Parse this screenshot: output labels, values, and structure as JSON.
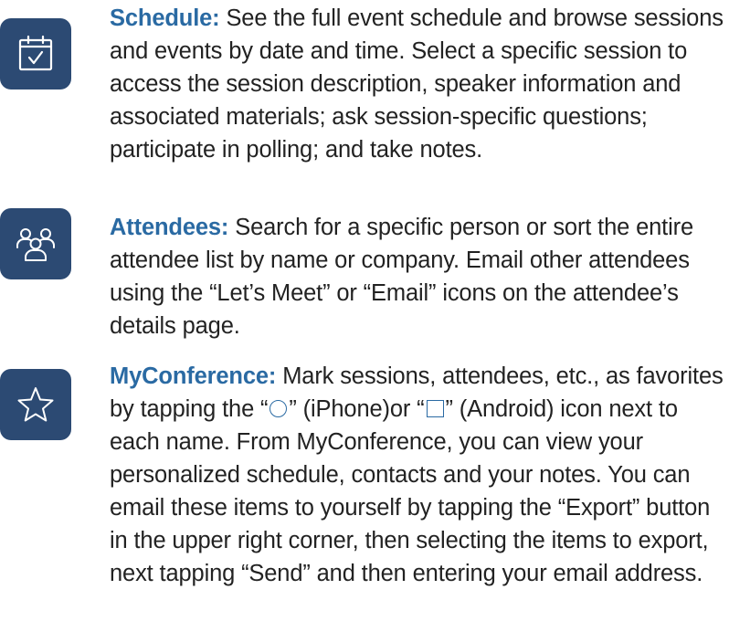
{
  "colors": {
    "icon_tile": "#2c4a73",
    "title": "#2a6aa3",
    "body_text": "#222222"
  },
  "items": [
    {
      "icon": "calendar-check-icon",
      "title": "Schedule:",
      "body": " See the full event schedule and browse sessions and events by date and time. Select a specific session to access the session description, speaker information and associated materials; ask session-specific questions; participate in polling; and take notes."
    },
    {
      "icon": "attendees-group-icon",
      "title": "Attendees:",
      "body": " Search for a specific person or sort the entire attendee list by name or company. Email other attendees using the “Let’s Meet” or “Email” icons on the attendee’s details page."
    },
    {
      "icon": "star-icon",
      "title": "MyConference:",
      "body_a": " Mark sessions, attendees, etc., as favorites by tapping the “",
      "body_b": "” (iPhone)or “",
      "body_c": "” (Android) icon next to each name. From MyConference, you can view your personalized schedule, contacts and your notes. You can email these items to yourself by tapping the “Export” button in the upper right corner, then selecting the items to export, next tapping “Send” and then entering your email address."
    }
  ]
}
